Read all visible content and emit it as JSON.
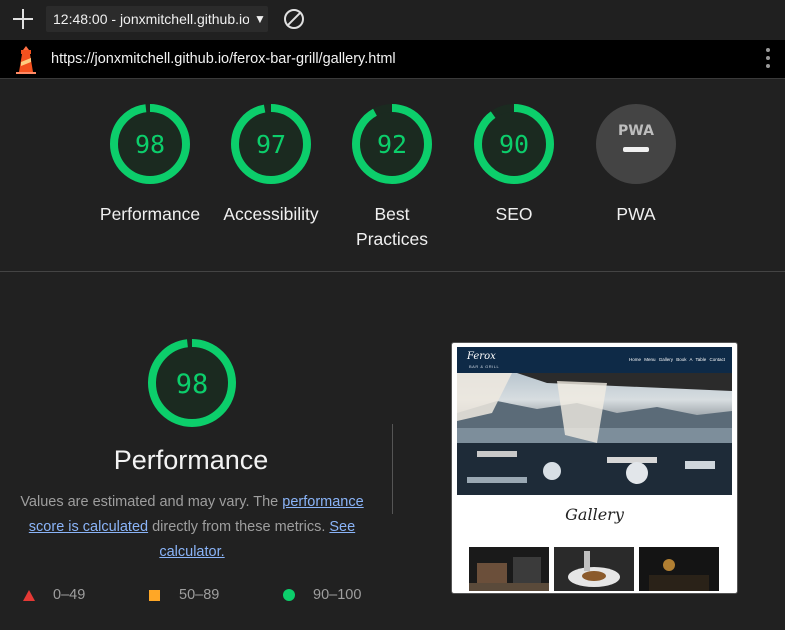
{
  "toolbar": {
    "new_icon": "plus-icon",
    "tab_text": "12:48:00 - jonxmitchell.github.io",
    "caret": "▼",
    "clear_icon": "block-icon"
  },
  "urlbar": {
    "logo": "lighthouse-icon",
    "url": "https://jonxmitchell.github.io/ferox-bar-grill/gallery.html",
    "menu_icon": "kebab-menu-icon"
  },
  "gauges": [
    {
      "value": "98",
      "score": 0.98,
      "label": "Performance",
      "color": "#0cce6b"
    },
    {
      "value": "97",
      "score": 0.97,
      "label": "Accessibility",
      "color": "#0cce6b"
    },
    {
      "value": "92",
      "score": 0.92,
      "label": "Best Practices",
      "color": "#0cce6b"
    },
    {
      "value": "90",
      "score": 0.9,
      "label": "SEO",
      "color": "#0cce6b"
    },
    {
      "value": "PWA",
      "label": "PWA",
      "color": "#444444"
    }
  ],
  "performance": {
    "score": "98",
    "fraction": 0.98,
    "title": "Performance",
    "desc_before": "Values are estimated and may vary. The ",
    "desc_link": "performance score is calculated",
    "desc_middle": " directly from these metrics. ",
    "desc_link2": "See calculator."
  },
  "legend": [
    {
      "range": "0–49",
      "color": "#e53935",
      "shape": "triangle"
    },
    {
      "range": "50–89",
      "color": "#ffa726",
      "shape": "square"
    },
    {
      "range": "90–100",
      "color": "#0cce6b",
      "shape": "circle"
    }
  ],
  "screenshot": {
    "logo": "Ferox",
    "sub": "BAR & GRILL",
    "links": "Home Menu Gallery Book A Table Contact",
    "heading": "Gallery"
  },
  "colors": {
    "pass": "#0cce6b",
    "pass_bg": "#1b2a20",
    "background": "#212121"
  }
}
